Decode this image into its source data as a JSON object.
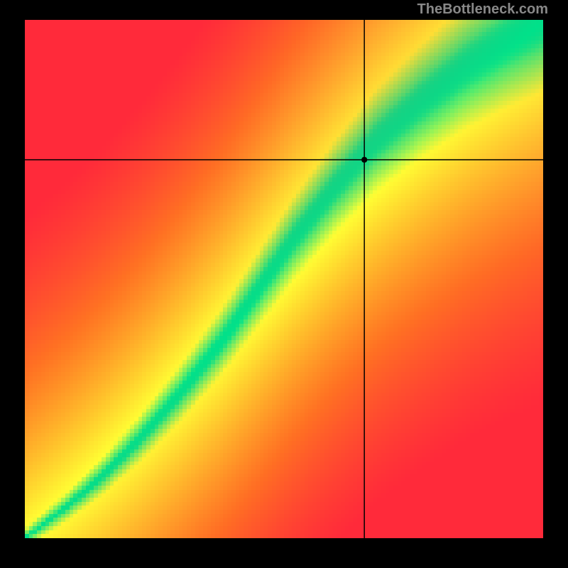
{
  "attribution": "TheBottleneck.com",
  "chart_data": {
    "type": "heatmap",
    "title": "",
    "xlabel": "",
    "ylabel": "",
    "xlim": [
      0,
      100
    ],
    "ylim": [
      0,
      100
    ],
    "crosshair": {
      "x": 65.5,
      "y": 73
    },
    "marker": {
      "x": 65.5,
      "y": 73,
      "radius": 4
    },
    "ridge": [
      {
        "x": 0,
        "y": 0
      },
      {
        "x": 8,
        "y": 6
      },
      {
        "x": 15,
        "y": 12
      },
      {
        "x": 22,
        "y": 19
      },
      {
        "x": 30,
        "y": 28
      },
      {
        "x": 38,
        "y": 38
      },
      {
        "x": 45,
        "y": 48
      },
      {
        "x": 52,
        "y": 58
      },
      {
        "x": 60,
        "y": 68
      },
      {
        "x": 68,
        "y": 77
      },
      {
        "x": 76,
        "y": 84
      },
      {
        "x": 85,
        "y": 91
      },
      {
        "x": 93,
        "y": 96
      },
      {
        "x": 100,
        "y": 100
      }
    ],
    "color_stops": {
      "green": "#00e18a",
      "yellow": "#ffff33",
      "orange": "#ff8a1a",
      "red": "#ff2a3a"
    }
  }
}
